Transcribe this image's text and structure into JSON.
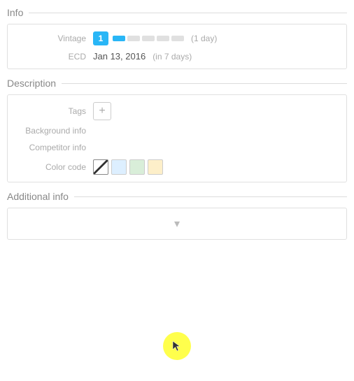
{
  "sections": {
    "info": {
      "title": "Info",
      "fields": {
        "vintage": {
          "label": "Vintage",
          "badge_value": "1",
          "duration_text": "(1 day)",
          "segments": [
            true,
            false,
            false,
            false,
            false
          ]
        },
        "ecd": {
          "label": "ECD",
          "date": "Jan 13, 2016",
          "days_text": "(in 7 days)"
        }
      }
    },
    "description": {
      "title": "Description",
      "fields": {
        "tags": {
          "label": "Tags",
          "add_button_icon": "+"
        },
        "background_info": {
          "label": "Background info"
        },
        "competitor_info": {
          "label": "Competitor info"
        },
        "color_code": {
          "label": "Color code",
          "swatches": [
            {
              "type": "slash",
              "color": ""
            },
            {
              "type": "solid",
              "color": "#ddefff"
            },
            {
              "type": "solid",
              "color": "#d9eed9"
            },
            {
              "type": "solid",
              "color": "#fdefc9"
            }
          ]
        }
      }
    },
    "additional_info": {
      "title": "Additional info",
      "chevron_label": "▾"
    }
  },
  "cursor": {
    "visible": true
  }
}
